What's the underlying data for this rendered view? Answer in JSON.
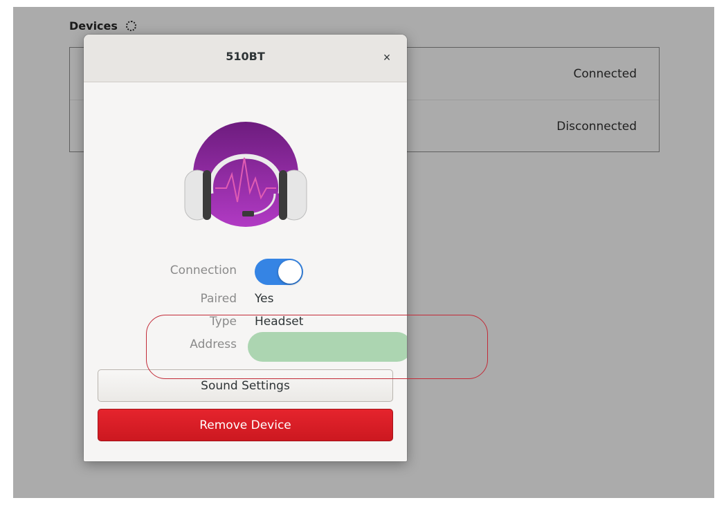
{
  "devices": {
    "title": "Devices",
    "rows": [
      {
        "status": "Connected"
      },
      {
        "status": "Disconnected"
      }
    ]
  },
  "dialog": {
    "title": "510BT",
    "close_glyph": "×",
    "connection_label": "Connection",
    "connection_on": true,
    "paired_label": "Paired",
    "paired_value": "Yes",
    "type_label": "Type",
    "type_value": "Headset",
    "address_label": "Address",
    "sound_settings_label": "Sound Settings",
    "remove_label": "Remove Device"
  },
  "icons": {
    "refresh": "spinner-icon",
    "device": "headset-icon",
    "close": "close-icon"
  },
  "colors": {
    "toggle_on": "#3584e4",
    "remove_button": "#d91f28",
    "annotation": "#c22a37",
    "redaction": "#acd5b1",
    "headset_purple": "#8e2a9f"
  }
}
